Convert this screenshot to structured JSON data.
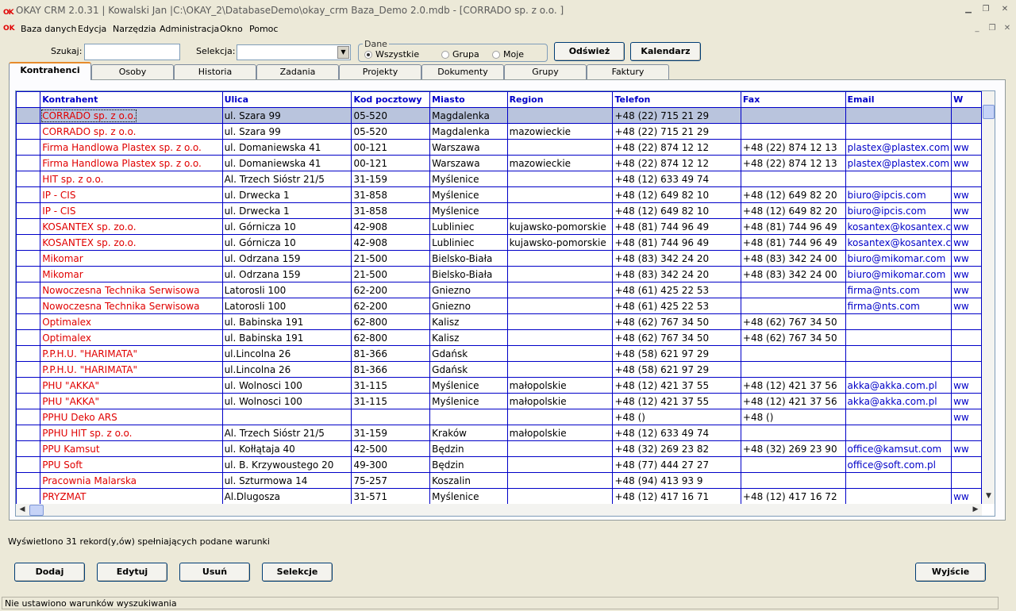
{
  "window": {
    "title": "OKAY CRM 2.0.31 | Kowalski Jan |C:\\OKAY_2\\DatabaseDemo\\okay_crm Baza_Demo 2.0.mdb - [CORRADO sp. z o.o. ]",
    "logo_text": "OK",
    "accent": "#e00000"
  },
  "menu": [
    "Baza danych",
    "Edycja",
    "Narzędzia",
    "Administracja",
    "Okno",
    "Pomoc"
  ],
  "toolbar": {
    "search_label": "Szukaj:",
    "search_value": "",
    "selection_label": "Selekcja:",
    "selection_value": "",
    "group_title": "Dane",
    "radio_all": "Wszystkie",
    "radio_group": "Grupa",
    "radio_mine": "Moje",
    "refresh_button": "Odśwież",
    "calendar_button": "Kalendarz"
  },
  "tabs": [
    "Kontrahenci",
    "Osoby",
    "Historia",
    "Zadania",
    "Projekty",
    "Dokumenty",
    "Grupy",
    "Faktury"
  ],
  "grid": {
    "columns": [
      "",
      "Kontrahent",
      "Ulica",
      "Kod pocztowy",
      "Miasto",
      "Region",
      "Telefon",
      "Fax",
      "Email",
      "W"
    ],
    "rows": [
      [
        "",
        "CORRADO sp. z o.o.",
        "ul. Szara 99",
        "05-520",
        "Magdalenka",
        "",
        "+48 (22) 715 21 29",
        "",
        "",
        ""
      ],
      [
        "",
        "CORRADO sp. z o.o.",
        "ul. Szara 99",
        "05-520",
        "Magdalenka",
        "mazowieckie",
        "+48 (22) 715 21 29",
        "",
        "",
        ""
      ],
      [
        "",
        "Firma Handlowa Plastex sp. z o.o.",
        "ul. Domaniewska 41",
        "00-121",
        "Warszawa",
        "",
        "+48 (22) 874 12 12",
        "+48 (22) 874 12 13",
        "plastex@plastex.com",
        "ww"
      ],
      [
        "",
        "Firma Handlowa Plastex sp. z o.o.",
        "ul. Domaniewska 41",
        "00-121",
        "Warszawa",
        "mazowieckie",
        "+48 (22) 874 12 12",
        "+48 (22) 874 12 13",
        "plastex@plastex.com",
        "ww"
      ],
      [
        "",
        "HIT sp. z o.o.",
        "Al. Trzech Sióstr 21/5",
        "31-159",
        "Myślenice",
        "",
        "+48 (12) 633 49 74",
        "",
        "",
        ""
      ],
      [
        "",
        "IP - CIS",
        "ul. Drwecka 1",
        "31-858",
        "Myślenice",
        "",
        "+48 (12) 649 82 10",
        "+48 (12) 649 82 20",
        "biuro@ipcis.com",
        "ww"
      ],
      [
        "",
        "IP - CIS",
        "ul. Drwecka 1",
        "31-858",
        "Myślenice",
        "",
        "+48 (12) 649 82 10",
        "+48 (12) 649 82 20",
        "biuro@ipcis.com",
        "ww"
      ],
      [
        "",
        "KOSANTEX sp. zo.o.",
        "ul. Górnicza 10",
        "42-908",
        "Lubliniec",
        "kujawsko-pomorskie",
        "+48 (81) 744 96 49",
        "+48 (81) 744 96 49",
        "kosantex@kosantex.c",
        "ww"
      ],
      [
        "",
        "KOSANTEX sp. zo.o.",
        "ul. Górnicza 10",
        " 42-908",
        "Lubliniec",
        "kujawsko-pomorskie",
        "+48 (81) 744 96 49",
        "+48 (81) 744 96 49",
        "kosantex@kosantex.c",
        "ww"
      ],
      [
        "",
        "Mikomar",
        "ul. Odrzana 159",
        "21-500",
        "Bielsko-Biała",
        "",
        "+48 (83) 342 24 20",
        "+48 (83) 342 24 00",
        "biuro@mikomar.com",
        "ww"
      ],
      [
        "",
        "Mikomar",
        "ul. Odrzana 159",
        "21-500",
        "Bielsko-Biała",
        "",
        "+48 (83) 342 24 20",
        "+48 (83) 342 24 00",
        "biuro@mikomar.com",
        "ww"
      ],
      [
        "",
        "Nowoczesna Technika Serwisowa",
        "Latorosli 100",
        "62-200",
        "Gniezno",
        "",
        "+48 (61) 425 22 53",
        "",
        "firma@nts.com",
        "ww"
      ],
      [
        "",
        "Nowoczesna Technika Serwisowa",
        "Latorosli 100",
        "62-200",
        "Gniezno",
        "",
        "+48 (61) 425 22 53",
        "",
        "firma@nts.com",
        "ww"
      ],
      [
        "",
        "Optimalex",
        "ul. Babinska 191",
        "62-800",
        "Kalisz",
        "",
        "+48 (62) 767 34 50",
        "+48 (62) 767 34 50",
        "",
        ""
      ],
      [
        "",
        "Optimalex",
        "ul. Babinska 191",
        "62-800",
        "Kalisz",
        "",
        "+48 (62) 767 34 50",
        "+48 (62) 767 34 50",
        "",
        ""
      ],
      [
        "",
        "P.P.H.U. \"HARIMATA\"",
        "ul.Lincolna 26",
        "81-366",
        "Gdańsk",
        "",
        "+48 (58) 621 97 29",
        "",
        "",
        ""
      ],
      [
        "",
        "P.P.H.U. \"HARIMATA\"",
        "ul.Lincolna 26",
        "81-366",
        "Gdańsk",
        "",
        "+48 (58) 621 97 29",
        "",
        "",
        ""
      ],
      [
        "",
        "PHU \"AKKA\"",
        "ul. Wolnosci 100",
        "31-115",
        "Myślenice",
        "małopolskie",
        "+48 (12) 421 37 55",
        "+48 (12) 421 37 56",
        "akka@akka.com.pl",
        "ww"
      ],
      [
        "",
        "PHU \"AKKA\"",
        "ul. Wolnosci 100",
        "31-115",
        "Myślenice",
        "małopolskie",
        "+48 (12) 421 37 55",
        "+48 (12) 421 37 56",
        "akka@akka.com.pl",
        "ww"
      ],
      [
        "",
        "PPHU Deko ARS",
        "",
        "",
        "",
        "",
        "+48 ()",
        "+48 ()",
        "",
        "ww"
      ],
      [
        "",
        "PPHU HIT sp. z o.o.",
        "Al. Trzech Sióstr 21/5",
        "31-159",
        "Kraków",
        "małopolskie",
        "+48 (12) 633 49 74",
        "",
        "",
        ""
      ],
      [
        "",
        "PPU Kamsut",
        "ul. Kołłątaja 40",
        "42-500",
        "Będzin",
        "",
        "+48 (32) 269 23 82",
        "+48 (32) 269 23 90",
        "office@kamsut.com",
        "ww"
      ],
      [
        "",
        "PPU Soft",
        "ul. B. Krzywoustego 20",
        "49-300",
        "Będzin",
        "",
        "+48 (77) 444 27 27",
        "",
        "office@soft.com.pl",
        ""
      ],
      [
        "",
        "Pracownia Malarska",
        "ul. Szturmowa 14",
        "75-257",
        "Koszalin",
        "",
        "+48 (94) 413 93 9",
        "",
        "",
        ""
      ],
      [
        "",
        "PRYZMAT",
        "Al.Dlugosza",
        "31-571",
        "Myślenice",
        "",
        "+48 (12) 417 16 71",
        "+48 (12) 417 16 72",
        "",
        "ww"
      ]
    ]
  },
  "footer": {
    "record_message": "Wyświetlono 31 rekord(y,ów) spełniających podane warunki",
    "add_button": "Dodaj",
    "edit_button": "Edytuj",
    "delete_button": "Usuń",
    "selections_button": "Selekcje",
    "exit_button": "Wyjście",
    "status_text": "Nie ustawiono warunków wyszukiwania"
  }
}
